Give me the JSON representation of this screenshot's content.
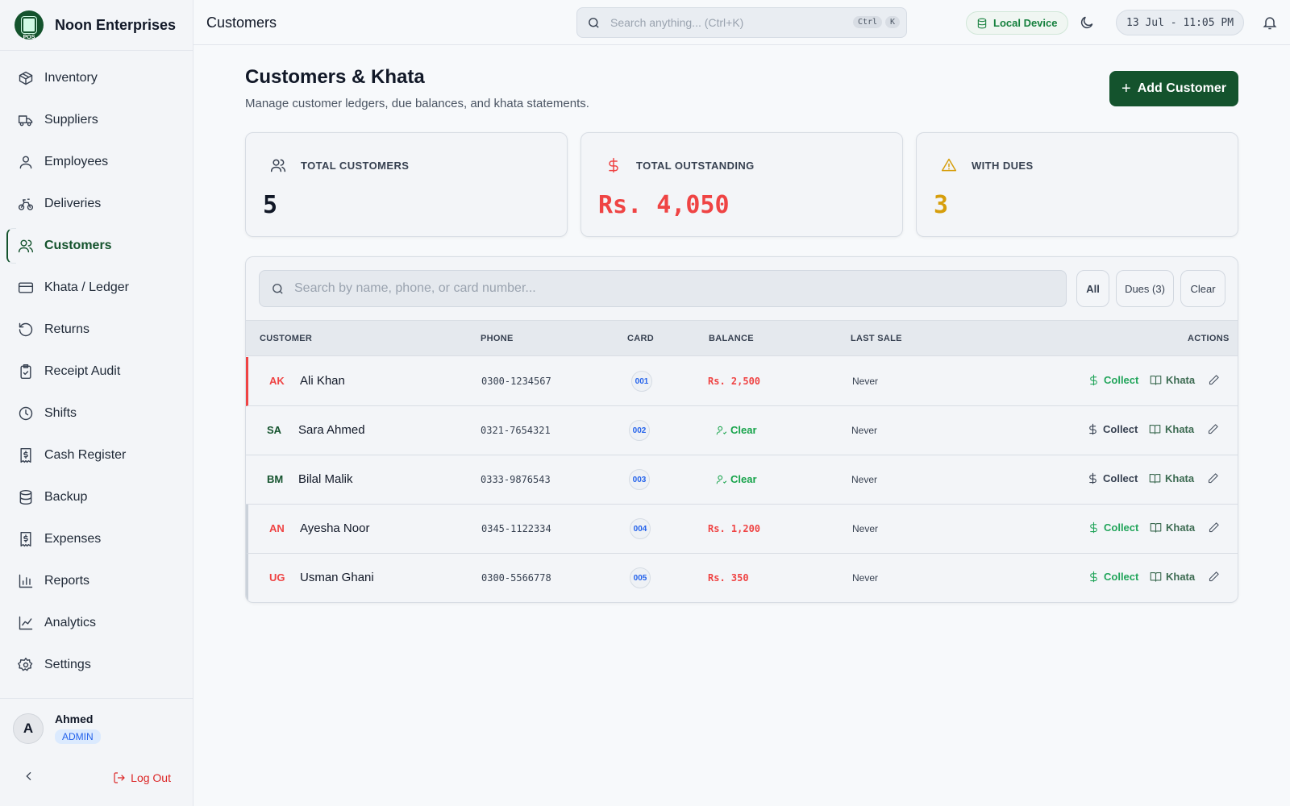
{
  "brand": {
    "name": "Noon Enterprises",
    "logo_text": "POS"
  },
  "sidebar": {
    "items": [
      {
        "label": "Inventory",
        "icon": "box-icon"
      },
      {
        "label": "Suppliers",
        "icon": "truck-icon"
      },
      {
        "label": "Employees",
        "icon": "user-icon"
      },
      {
        "label": "Deliveries",
        "icon": "bike-icon"
      },
      {
        "label": "Customers",
        "icon": "users-icon",
        "active": true
      },
      {
        "label": "Khata / Ledger",
        "icon": "credit-card-icon"
      },
      {
        "label": "Returns",
        "icon": "rotate-ccw-icon"
      },
      {
        "label": "Receipt Audit",
        "icon": "clipboard-check-icon"
      },
      {
        "label": "Shifts",
        "icon": "clock-icon"
      },
      {
        "label": "Cash Register",
        "icon": "receipt-dollar-icon"
      },
      {
        "label": "Backup",
        "icon": "database-icon"
      },
      {
        "label": "Expenses",
        "icon": "receipt-icon"
      },
      {
        "label": "Reports",
        "icon": "bar-chart-icon"
      },
      {
        "label": "Analytics",
        "icon": "line-chart-icon"
      },
      {
        "label": "Settings",
        "icon": "gear-icon"
      }
    ]
  },
  "user": {
    "initial": "A",
    "name": "Ahmed",
    "role": "ADMIN"
  },
  "logout_label": "Log Out",
  "topbar": {
    "title": "Customers",
    "search_placeholder": "Search anything... (Ctrl+K)",
    "kbd_ctrl": "Ctrl",
    "kbd_k": "K",
    "device": "Local Device",
    "datetime": "13 Jul - 11:05 PM"
  },
  "main": {
    "title": "Customers & Khata",
    "subtitle": "Manage customer ledgers, due balances, and khata statements.",
    "add_button": "Add Customer"
  },
  "stats": {
    "total_customers": {
      "label": "TOTAL CUSTOMERS",
      "value": "5"
    },
    "total_outstanding": {
      "label": "TOTAL OUTSTANDING",
      "value": "Rs. 4,050"
    },
    "with_dues": {
      "label": "WITH DUES",
      "value": "3"
    }
  },
  "table": {
    "search_placeholder": "Search by name, phone, or card number...",
    "filters": {
      "all": "All",
      "dues": "Dues (3)",
      "clear": "Clear"
    },
    "headers": {
      "customer": "CUSTOMER",
      "phone": "PHONE",
      "card": "CARD",
      "balance": "BALANCE",
      "last_sale": "LAST SALE",
      "actions": "ACTIONS"
    },
    "actions": {
      "collect": "Collect",
      "khata": "Khata"
    },
    "rows": [
      {
        "initials": "AK",
        "name": "Ali Khan",
        "phone": "0300-1234567",
        "card": "001",
        "balance": "Rs. 2,500",
        "due": true,
        "last_sale": "Never"
      },
      {
        "initials": "SA",
        "name": "Sara Ahmed",
        "phone": "0321-7654321",
        "card": "002",
        "balance": "Clear",
        "due": false,
        "last_sale": "Never"
      },
      {
        "initials": "BM",
        "name": "Bilal Malik",
        "phone": "0333-9876543",
        "card": "003",
        "balance": "Clear",
        "due": false,
        "last_sale": "Never"
      },
      {
        "initials": "AN",
        "name": "Ayesha Noor",
        "phone": "0345-1122334",
        "card": "004",
        "balance": "Rs. 1,200",
        "due": true,
        "last_sale": "Never"
      },
      {
        "initials": "UG",
        "name": "Usman Ghani",
        "phone": "0300-5566778",
        "card": "005",
        "balance": "Rs. 350",
        "due": true,
        "last_sale": "Never"
      }
    ]
  },
  "colors": {
    "brand": "#14532d",
    "due": "#ef4444",
    "clear": "#16a34a",
    "warning": "#d69e0c",
    "accent": "#2563eb"
  }
}
